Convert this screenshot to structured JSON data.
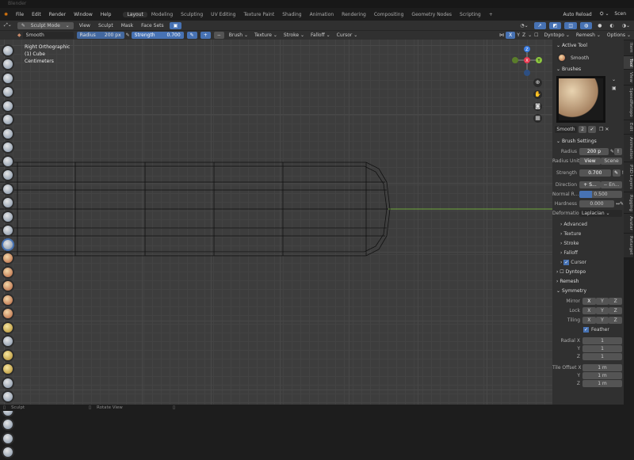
{
  "app": {
    "title": "Blender"
  },
  "menu": {
    "items": [
      "File",
      "Edit",
      "Render",
      "Window",
      "Help"
    ],
    "workspaces": [
      "Layout",
      "Modeling",
      "Sculpting",
      "UV Editing",
      "Texture Paint",
      "Shading",
      "Animation",
      "Rendering",
      "Compositing",
      "Geometry Nodes",
      "Scripting",
      "+"
    ],
    "auto_reload": "Auto Reload",
    "scene": "Scen"
  },
  "header": {
    "mode": "Sculpt Mode",
    "items": [
      "View",
      "Sculpt",
      "Mask",
      "Face Sets"
    ]
  },
  "toolsettings": {
    "brush": "Smooth",
    "radius_label": "Radius",
    "radius": "200 px",
    "strength_label": "Strength",
    "strength": "0.700",
    "menus": [
      "Brush",
      "Texture",
      "Stroke",
      "Falloff",
      "Cursor"
    ],
    "axes": [
      "X",
      "Y",
      "Z"
    ],
    "right_menus": [
      "Dyntopo",
      "Remesh",
      "Options"
    ]
  },
  "viewport": {
    "view": "Right Orthographic",
    "object": "(1) Cube",
    "units": "Centimeters",
    "gizmo": {
      "z": "Z",
      "y": "Y",
      "x": "X"
    }
  },
  "sidebar": {
    "active_tool": {
      "header": "Active Tool",
      "name": "Smooth"
    },
    "brushes": {
      "header": "Brushes",
      "name": "Smooth",
      "users": "2"
    },
    "brush_settings": {
      "header": "Brush Settings",
      "radius_label": "Radius",
      "radius": "200 p",
      "radius_unit_label": "Radius Unit",
      "unit_view": "View",
      "unit_scene": "Scene",
      "strength_label": "Strength",
      "strength": "0.700",
      "direction_label": "Direction",
      "dir_add": "+ S...",
      "dir_sub": "− En...",
      "normal_label": "Normal R...",
      "normal": "0.500",
      "normal_fraction": 0.3,
      "hardness_label": "Hardness",
      "hardness": "0.000",
      "deformation_label": "Deformation",
      "deformation": "Laplacian"
    },
    "subpanels": [
      "Advanced",
      "Texture",
      "Stroke",
      "Falloff"
    ],
    "cursor": "Cursor",
    "dyntopo": "Dyntopo",
    "remesh": "Remesh",
    "symmetry": {
      "header": "Symmetry",
      "mirror_label": "Mirror",
      "lock_label": "Lock",
      "tiling_label": "Tiling",
      "axes": [
        "X",
        "Y",
        "Z"
      ],
      "feather": "Feather",
      "radial_x_label": "Radial X",
      "y_label": "Y",
      "z_label": "Z",
      "radial": [
        "1",
        "1",
        "1"
      ],
      "tile_offset_label": "Tile Offset X",
      "tile_offset": [
        "1 m",
        "1 m",
        "1 m"
      ]
    }
  },
  "tabs": [
    "Item",
    "Tool",
    "View",
    "SpeedRetopo",
    "Edit",
    "Animation",
    "PSD Layers",
    "Rigging",
    "Avatar",
    "Retarget"
  ],
  "status": {
    "left": "Sculpt",
    "middle": "Rotate View"
  },
  "colors": {
    "accent": "#4772b3",
    "x_axis": "#e8384f",
    "y_axis": "#8cc63e",
    "z_axis": "#3a7be0"
  }
}
